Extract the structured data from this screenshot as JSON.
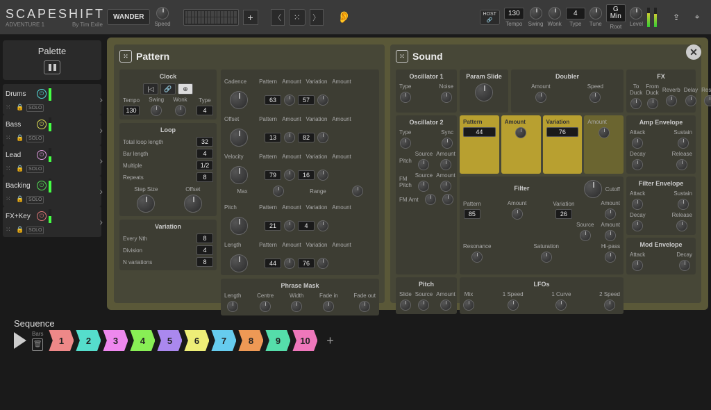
{
  "header": {
    "logo": "SCAPESHIFT",
    "sub1": "ADVENTURE 1",
    "sub2": "By Tim Exile",
    "wander": "WANDER",
    "speed": "Speed",
    "host": "HOST",
    "link": "🔗",
    "tempo_lbl": "Tempo",
    "tempo": "130",
    "swing": "Swing",
    "wonk": "Wonk",
    "type_lbl": "Type",
    "type": "4",
    "tune": "Tune",
    "root_lbl": "Root",
    "root": "G\nMin",
    "level": "Level"
  },
  "palette": {
    "title": "Palette"
  },
  "tracks": [
    {
      "name": "Drums",
      "solo": "SOLO",
      "meter": 90,
      "color": "teal"
    },
    {
      "name": "Bass",
      "solo": "SOLO",
      "meter": 60,
      "color": "yel"
    },
    {
      "name": "Lead",
      "solo": "SOLO",
      "meter": 40,
      "color": "pnk"
    },
    {
      "name": "Backing",
      "solo": "SOLO",
      "meter": 85,
      "color": "grn"
    },
    {
      "name": "FX+Key",
      "solo": "SOLO",
      "meter": 50,
      "color": "red"
    }
  ],
  "pattern": {
    "title": "Pattern",
    "clock": {
      "title": "Clock",
      "tempo_lbl": "Tempo",
      "tempo": "130",
      "swing": "Swing",
      "wonk": "Wonk",
      "type_lbl": "Type",
      "type": "4"
    },
    "loop": {
      "title": "Loop",
      "tll": "Total loop length",
      "tllv": "32",
      "bl": "Bar length",
      "blv": "4",
      "mu": "Multiple",
      "muv": "1/2",
      "rp": "Repeats",
      "rpv": "8",
      "ss": "Step Size",
      "of": "Offset"
    },
    "variation": {
      "title": "Variation",
      "en": "Every Nth",
      "env": "8",
      "dv": "Division",
      "dvv": "4",
      "nv": "N variations",
      "nvv": "8"
    },
    "cols": {
      "cadence": "Cadence",
      "offset": "Offset",
      "velocity": "Velocity",
      "pitch": "Pitch",
      "length": "Length",
      "pattern": "Pattern",
      "amount": "Amount",
      "var": "Variation",
      "max": "Max",
      "range": "Range"
    },
    "vals": {
      "p1": "63",
      "v1": "57",
      "p2": "13",
      "v2": "82",
      "p3": "79",
      "v3": "16",
      "p4": "21",
      "v4": "4",
      "p5": "44",
      "v5": "76"
    },
    "phrase": {
      "title": "Phrase Mask",
      "l": "Length",
      "c": "Centre",
      "w": "Width",
      "fi": "Fade in",
      "fo": "Fade out"
    }
  },
  "sound": {
    "title": "Sound",
    "osc1": {
      "title": "Oscillator 1",
      "type": "Type",
      "noise": "Noise"
    },
    "pslide": {
      "title": "Param Slide"
    },
    "doubler": {
      "title": "Doubler",
      "amt": "Amount",
      "spd": "Speed"
    },
    "fx": {
      "title": "FX",
      "td": "To\nDuck",
      "fd": "From\nDuck",
      "rv": "Reverb",
      "dl": "Delay",
      "rs": "Reson"
    },
    "osc2": {
      "title": "Oscillator 2",
      "type": "Type",
      "sync": "Sync",
      "pitch": "Pitch",
      "src": "Source",
      "amt": "Amount",
      "fmp": "FM Pitch",
      "fma": "FM Amt"
    },
    "hl": {
      "pattern": "Pattern",
      "pval": "44",
      "amount": "Amount",
      "var": "Variation",
      "vval": "76",
      "amt2": "Amount"
    },
    "filter": {
      "title": "Filter",
      "cutoff": "Cutoff",
      "pattern": "Pattern",
      "pval": "85",
      "amount": "Amount",
      "var": "Variation",
      "vval": "26",
      "amt2": "Amount",
      "src": "Source",
      "amt": "Amount",
      "res": "Resonance",
      "sat": "Saturation",
      "hp": "Hi-pass"
    },
    "amp": {
      "title": "Amp Envelope",
      "a": "Attack",
      "s": "Sustain",
      "d": "Decay",
      "r": "Release"
    },
    "fenv": {
      "title": "Filter Envelope",
      "a": "Attack",
      "s": "Sustain",
      "d": "Decay",
      "r": "Release"
    },
    "menv": {
      "title": "Mod Envelope",
      "a": "Attack",
      "d": "Decay"
    },
    "pitch": {
      "title": "Pitch",
      "slide": "Slide",
      "src": "Source",
      "amt": "Amount"
    },
    "lfos": {
      "title": "LFOs",
      "mix": "Mix",
      "s1": "1 Speed",
      "c1": "1 Curve",
      "s2": "2 Speed"
    }
  },
  "seq": {
    "title": "Sequence",
    "bars": "Bars",
    "steps": [
      {
        "n": "1",
        "c": "#e88"
      },
      {
        "n": "2",
        "c": "#5dc"
      },
      {
        "n": "3",
        "c": "#e8e"
      },
      {
        "n": "4",
        "c": "#8e5"
      },
      {
        "n": "5",
        "c": "#a8e"
      },
      {
        "n": "6",
        "c": "#ee7"
      },
      {
        "n": "7",
        "c": "#6ce"
      },
      {
        "n": "8",
        "c": "#e95"
      },
      {
        "n": "9",
        "c": "#5da"
      },
      {
        "n": "10",
        "c": "#e7b"
      }
    ]
  }
}
